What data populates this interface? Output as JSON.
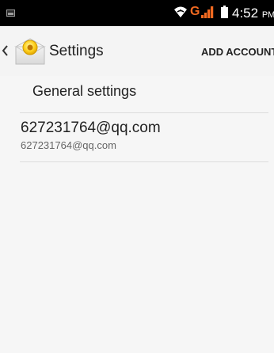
{
  "status_bar": {
    "network_type": "G",
    "time": "4:52",
    "ampm": "PM",
    "network_color": "#f26a21"
  },
  "action_bar": {
    "title": "Settings",
    "add_account_label": "ADD ACCOUNT",
    "icons": {
      "up": "chevron-left-icon",
      "app": "email-app-icon"
    }
  },
  "list": {
    "general_settings": "General settings",
    "account": {
      "primary": "627231764@qq.com",
      "secondary": "627231764@qq.com"
    }
  }
}
